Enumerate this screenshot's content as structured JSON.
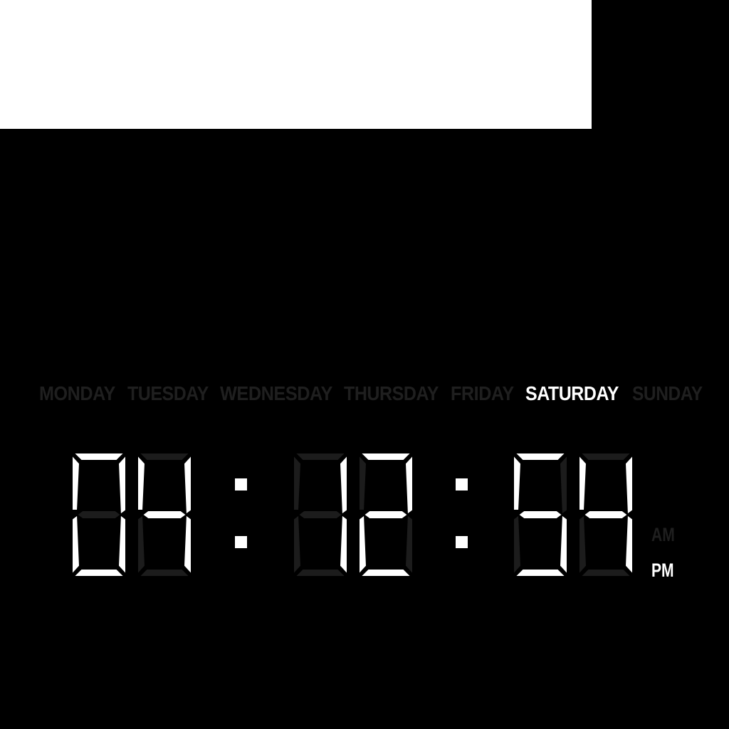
{
  "colors": {
    "background": "#000000",
    "panel": "#ffffff",
    "lit": "#ffffff",
    "unlit_segment": "#1c1c1c",
    "dim_text": "#1f1f1f"
  },
  "days": [
    {
      "label": "MONDAY",
      "active": false
    },
    {
      "label": "TUESDAY",
      "active": false
    },
    {
      "label": "WEDNESDAY",
      "active": false
    },
    {
      "label": "THURSDAY",
      "active": false
    },
    {
      "label": "FRIDAY",
      "active": false
    },
    {
      "label": "SATURDAY",
      "active": true
    },
    {
      "label": "SUNDAY",
      "active": false
    }
  ],
  "time": {
    "hours": "04",
    "minutes": "12",
    "seconds": "54"
  },
  "meridiem": {
    "am_label": "AM",
    "pm_label": "PM",
    "active": "PM"
  }
}
